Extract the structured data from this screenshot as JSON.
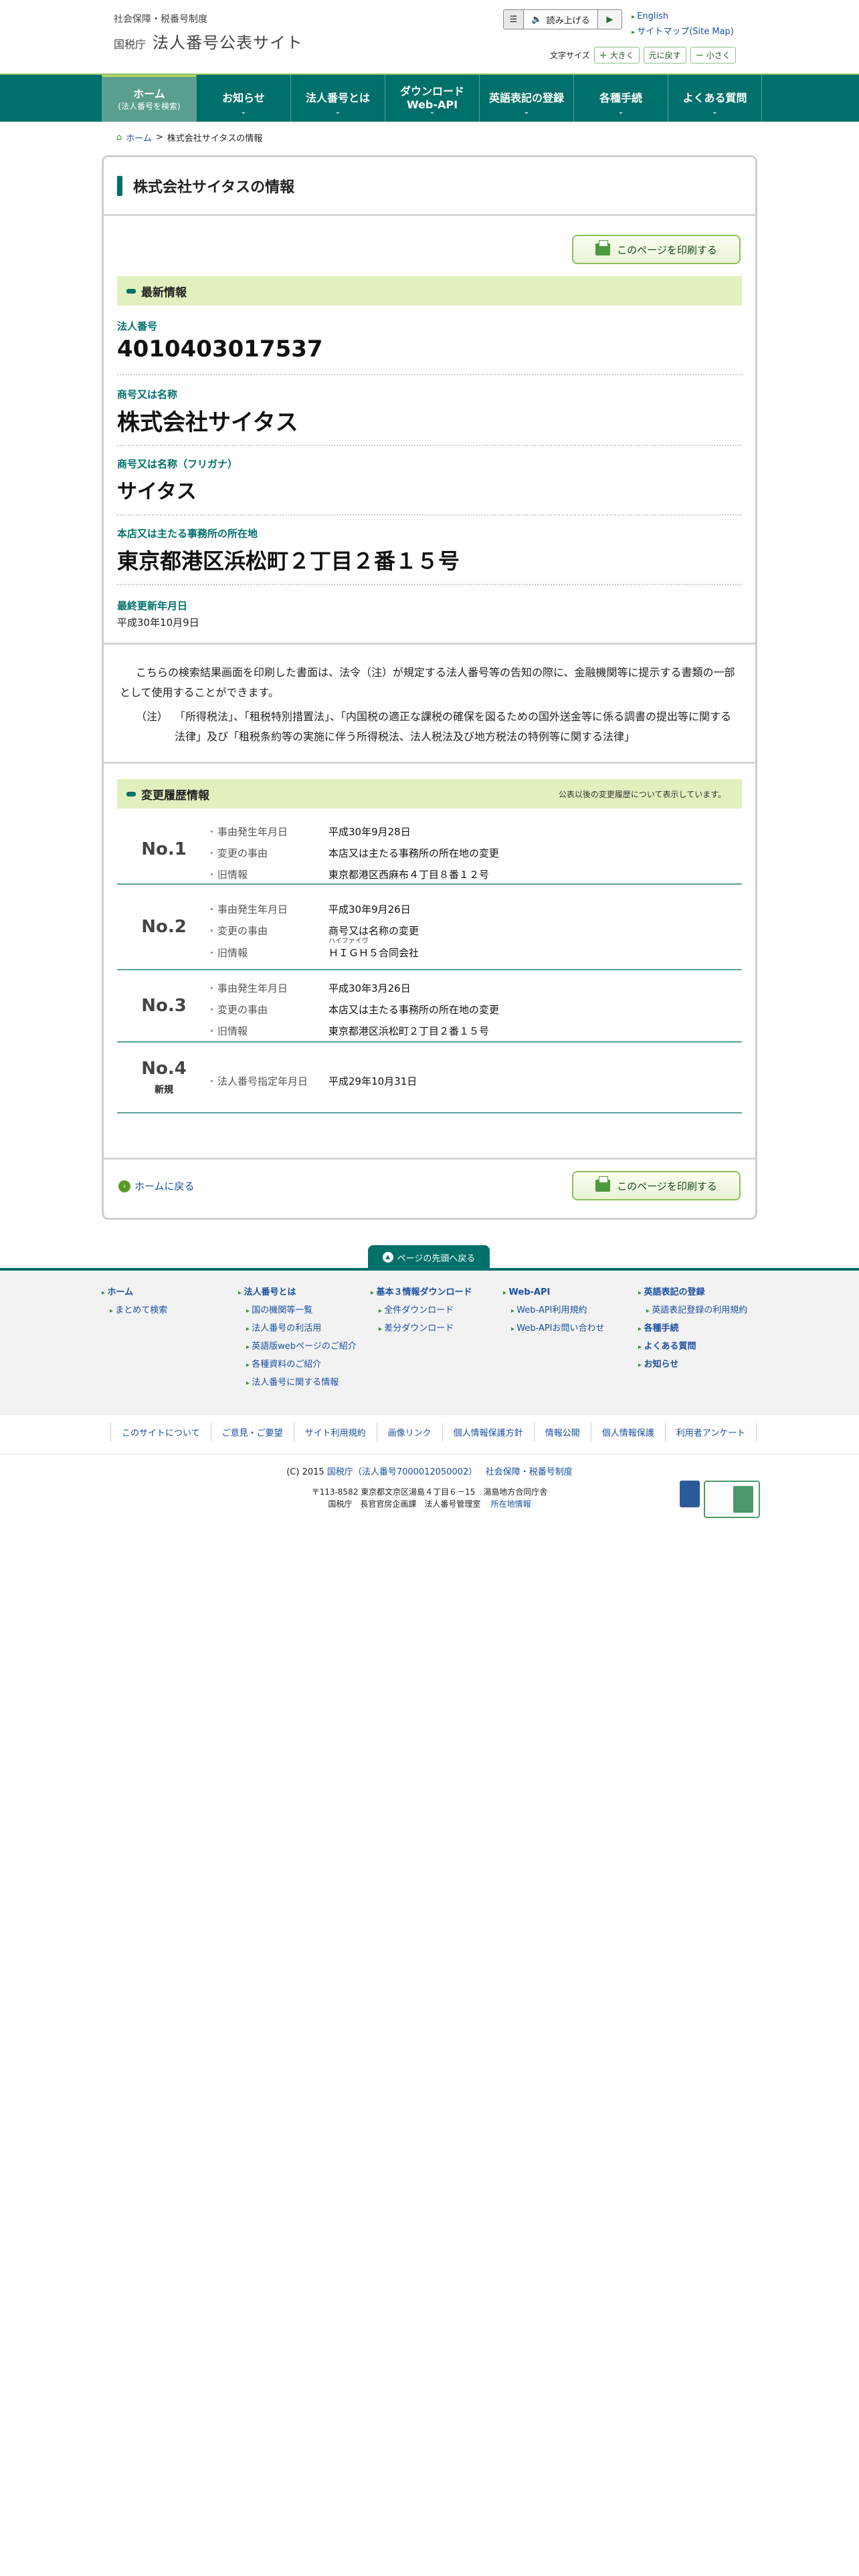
{
  "header": {
    "org_small": "社会保障・税番号制度",
    "agency": "国税庁",
    "site_title": "法人番号公表サイト",
    "read_aloud": "読み上げる",
    "english_link": "English",
    "sitemap_link": "サイトマップ(Site Map)",
    "font_size_label": "文字サイズ",
    "font_larger": "大きく",
    "font_reset": "元に戻す",
    "font_smaller": "小さく"
  },
  "nav": [
    {
      "label": "ホーム",
      "sub": "(法人番号を検索)"
    },
    {
      "label": "お知らせ",
      "sub": ""
    },
    {
      "label": "法人番号とは",
      "sub": ""
    },
    {
      "label": "ダウンロード",
      "sub": "Web-API"
    },
    {
      "label": "英語表記の登録",
      "sub": ""
    },
    {
      "label": "各種手続",
      "sub": ""
    },
    {
      "label": "よくある質問",
      "sub": ""
    }
  ],
  "breadcrumb": {
    "home": "ホーム",
    "sep": ">",
    "current": "株式会社サイタスの情報"
  },
  "page_title": "株式会社サイタスの情報",
  "print_label": "このページを印刷する",
  "latest": {
    "heading": "最新情報",
    "corp_no_label": "法人番号",
    "corp_no": "4010403017537",
    "name_label": "商号又は名称",
    "name": "株式会社サイタス",
    "kana_label": "商号又は名称（フリガナ）",
    "kana": "サイタス",
    "address_label": "本店又は主たる事務所の所在地",
    "address": "東京都港区浜松町２丁目２番１５号",
    "updated_label": "最終更新年月日",
    "updated": "平成30年10月9日"
  },
  "notice": {
    "first": "こちらの検索結果画面を印刷した書面は、法令（注）が規定する法人番号等の告知の際に、金融機関等に提示する書類の一部として使用することができます。",
    "note_tag": "（注）",
    "note": "「所得税法」、「租税特別措置法」、「内国税の適正な課税の確保を図るための国外送金等に係る調書の提出等に関する法律」及び「租税条約等の実施に伴う所得税法、法人税法及び地方税法の特例等に関する法律」"
  },
  "history": {
    "heading": "変更履歴情報",
    "note": "公表以後の変更履歴について表示しています。",
    "entries": [
      {
        "no": "No.1",
        "sub": "",
        "rows": [
          {
            "k": "事由発生年月日",
            "v": "平成30年9月28日",
            "ruby": ""
          },
          {
            "k": "変更の事由",
            "v": "本店又は主たる事務所の所在地の変更",
            "ruby": ""
          },
          {
            "k": "旧情報",
            "v": "東京都港区西麻布４丁目８番１２号",
            "ruby": ""
          }
        ]
      },
      {
        "no": "No.2",
        "sub": "",
        "rows": [
          {
            "k": "事由発生年月日",
            "v": "平成30年9月26日",
            "ruby": ""
          },
          {
            "k": "変更の事由",
            "v": "商号又は名称の変更",
            "ruby": ""
          },
          {
            "k": "旧情報",
            "v": "ＨＩＧＨ５合同会社",
            "ruby": "ハイファイヴ"
          }
        ]
      },
      {
        "no": "No.3",
        "sub": "",
        "rows": [
          {
            "k": "事由発生年月日",
            "v": "平成30年3月26日",
            "ruby": ""
          },
          {
            "k": "変更の事由",
            "v": "本店又は主たる事務所の所在地の変更",
            "ruby": ""
          },
          {
            "k": "旧情報",
            "v": "東京都港区浜松町２丁目２番１５号",
            "ruby": ""
          }
        ]
      },
      {
        "no": "No.4",
        "sub": "新規",
        "rows": [
          {
            "k": "法人番号指定年月日",
            "v": "平成29年10月31日",
            "ruby": ""
          }
        ]
      }
    ]
  },
  "back_home": "ホームに戻る",
  "page_top": "ページの先頭へ戻る",
  "footer": {
    "col1": {
      "h": "ホーム",
      "items": [
        "まとめて検索"
      ]
    },
    "col2": {
      "h": "法人番号とは",
      "items": [
        "国の機関等一覧",
        "法人番号の利活用",
        "英語版webページのご紹介",
        "各種資料のご紹介",
        "法人番号に関する情報"
      ]
    },
    "col3": {
      "h": "基本３情報ダウンロード",
      "items": [
        "全件ダウンロード",
        "差分ダウンロード"
      ]
    },
    "col4": {
      "h": "Web-API",
      "items": [
        "Web-API利用規約",
        "Web-APIお問い合わせ"
      ]
    },
    "col5": {
      "h": "英語表記の登録",
      "items": [
        "英語表記登録の利用規約"
      ],
      "extra": [
        "各種手続",
        "よくある質問",
        "お知らせ"
      ]
    },
    "links": [
      "このサイトについて",
      "ご意見・ご要望",
      "サイト利用規約",
      "画像リンク",
      "個人情報保護方針",
      "情報公開",
      "個人情報保護",
      "利用者アンケート"
    ],
    "copyright_prefix": "(C) 2015",
    "copyright_link": "国税庁（法人番号7000012050002）",
    "copyright_link2": "社会保障・税番号制度",
    "address_line1": "〒113-8582 東京都文京区湯島４丁目６－15　湯島地方合同庁舎",
    "address_line2": "国税庁　長官官房企画課　法人番号管理室",
    "address_link": "所在地情報"
  }
}
